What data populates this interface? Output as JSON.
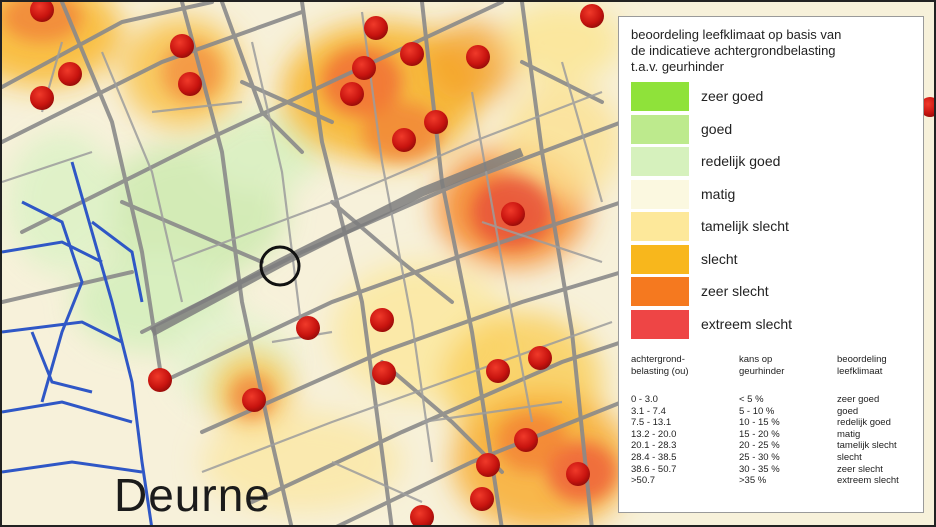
{
  "map": {
    "place_name": "Deurne",
    "colors": {
      "background": "#f7f1da",
      "roads": "#8c8c8c",
      "water": "#2f57c6",
      "hotspot": "#d61a1a"
    }
  },
  "legend": {
    "title_lines": [
      "beoordeling leefklimaat op basis van",
      "de indicatieve achtergrondbelasting",
      "t.a.v. geurhinder"
    ],
    "classes": [
      {
        "label": "zeer goed",
        "color": "#8fe23a"
      },
      {
        "label": "goed",
        "color": "#bdea8d"
      },
      {
        "label": "redelijk goed",
        "color": "#d6f1bd"
      },
      {
        "label": "matig",
        "color": "#fbf8e0"
      },
      {
        "label": "tamelijk slecht",
        "color": "#fde89a"
      },
      {
        "label": "slecht",
        "color": "#f8b71c"
      },
      {
        "label": "zeer slecht",
        "color": "#f5791f"
      },
      {
        "label": "extreem slecht",
        "color": "#ee4545"
      }
    ],
    "table": {
      "headers": [
        "achtergrond-\nbelasting (ou)",
        "kans op\ngeurhinder",
        "beoordeling\nleefklimaat"
      ],
      "rows": [
        [
          "0 - 3.0",
          "< 5 %",
          "zeer goed"
        ],
        [
          "3.1 - 7.4",
          "5 - 10 %",
          "goed"
        ],
        [
          "7.5 - 13.1",
          "10 - 15 %",
          "redelijk goed"
        ],
        [
          "13.2 - 20.0",
          "15 - 20 %",
          "matig"
        ],
        [
          "20.1 - 28.3",
          "20 - 25 %",
          "tamelijk slecht"
        ],
        [
          "28.4 - 38.5",
          "25 - 30 %",
          "slecht"
        ],
        [
          "38.6 - 50.7",
          "30 - 35 %",
          "zeer slecht"
        ],
        [
          ">50.7",
          ">35  %",
          "extreem slecht"
        ]
      ]
    }
  }
}
